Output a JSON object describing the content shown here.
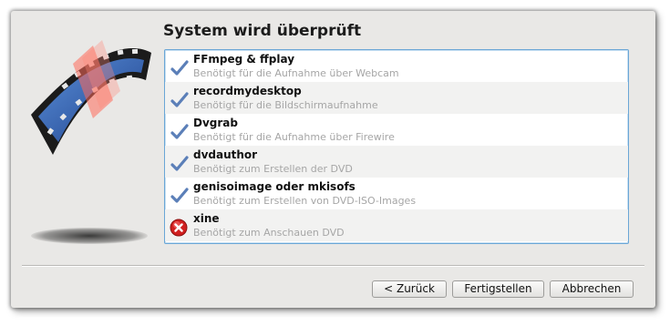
{
  "window": {
    "title": "System wird überprüft"
  },
  "checks": [
    {
      "name": "FFmpeg & ffplay",
      "description": "Benötigt für die Aufnahme über Webcam",
      "status": "ok",
      "icon": "checkmark-icon"
    },
    {
      "name": "recordmydesktop",
      "description": "Benötigt für die Bildschirmaufnahme",
      "status": "ok",
      "icon": "checkmark-icon"
    },
    {
      "name": "Dvgrab",
      "description": "Benötigt für die Aufnahme über Firewire",
      "status": "ok",
      "icon": "checkmark-icon"
    },
    {
      "name": "dvdauthor",
      "description": "Benötigt zum Erstellen der DVD",
      "status": "ok",
      "icon": "checkmark-icon"
    },
    {
      "name": "genisoimage oder mkisofs",
      "description": "Benötigt zum Erstellen von DVD-ISO-Images",
      "status": "ok",
      "icon": "checkmark-icon"
    },
    {
      "name": "xine",
      "description": "Benötigt zum Anschauen DVD",
      "status": "error",
      "icon": "error-icon"
    }
  ],
  "buttons": {
    "back": "< Zurück",
    "finish": "Fertigstellen",
    "cancel": "Abbrechen"
  },
  "colors": {
    "check": "#5b7fb8",
    "error": "#d02020",
    "list_border": "#6aa6d6",
    "window_bg": "#e9e8e6"
  },
  "logo": {
    "icon": "film-strip-icon"
  }
}
